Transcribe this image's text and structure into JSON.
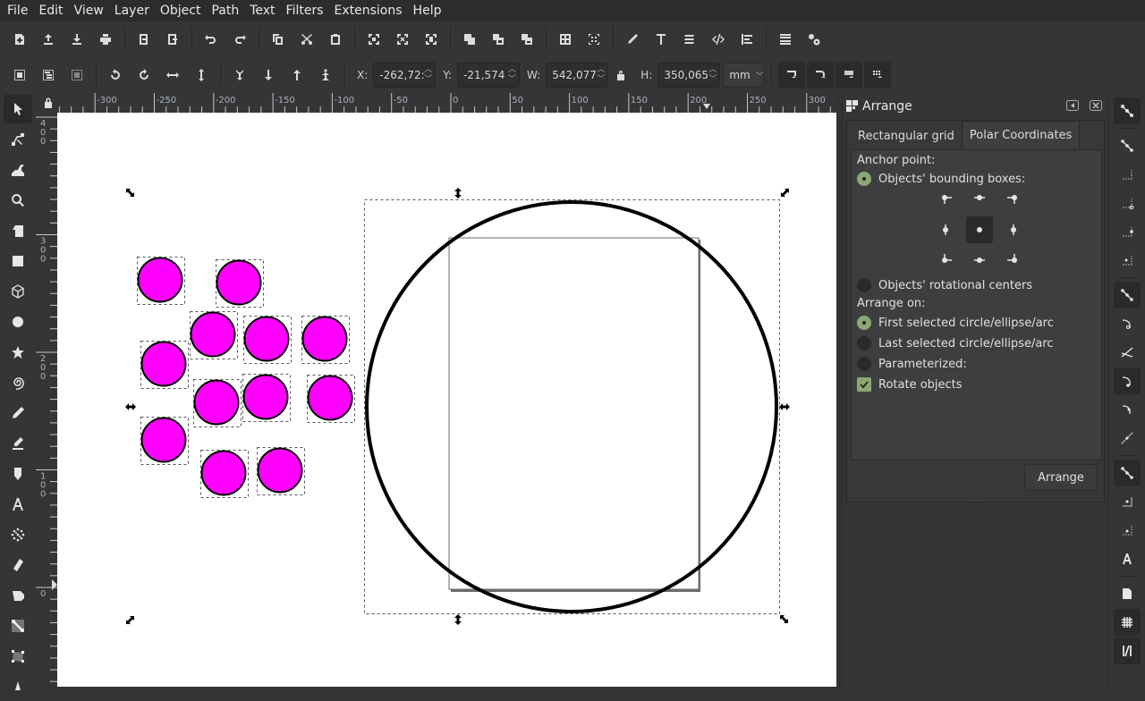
{
  "menu": [
    "File",
    "Edit",
    "View",
    "Layer",
    "Object",
    "Path",
    "Text",
    "Filters",
    "Extensions",
    "Help"
  ],
  "commands_toolbar": [
    "new-document-icon",
    "open-icon",
    "save-icon",
    "print-icon",
    "import-icon",
    "export-icon",
    "undo-icon",
    "redo-icon",
    "copy-icon",
    "cut-icon",
    "paste-icon",
    "zoom-selection-icon",
    "zoom-drawing-icon",
    "zoom-page-icon",
    "duplicate-icon",
    "clone-icon",
    "unlink-clone-icon",
    "group-icon",
    "ungroup-icon",
    "fill-stroke-icon",
    "text-font-icon",
    "layers-icon",
    "xml-editor-icon",
    "align-distribute-icon",
    "preferences-icon",
    "document-properties-icon"
  ],
  "select_toolbar": {
    "x_label": "X:",
    "x_value": "-262,72:",
    "y_label": "Y:",
    "y_value": "-21,574",
    "w_label": "W:",
    "w_value": "542,077",
    "h_label": "H:",
    "h_value": "350,065",
    "unit": "mm"
  },
  "rulers": {
    "top_ticks": [
      "-300",
      "-250",
      "-200",
      "-150",
      "-100",
      "-50",
      "0",
      "50",
      "100",
      "150",
      "200",
      "250",
      "300"
    ],
    "left_ticks": [
      "400",
      "300",
      "200",
      "100",
      "0"
    ]
  },
  "tools": [
    "selector-tool",
    "node-tool",
    "tweak-tool",
    "zoom-tool",
    "measure-tool",
    "rectangle-tool",
    "3d-box-tool",
    "ellipse-tool",
    "star-tool",
    "spiral-tool",
    "pencil-tool",
    "pen-tool",
    "calligraphy-tool",
    "text-tool",
    "spray-tool",
    "eraser-tool",
    "paint-bucket-tool",
    "gradient-tool",
    "mesh-tool",
    "dropper-tool"
  ],
  "dock": {
    "title": "Arrange",
    "tabs": [
      {
        "label": "Rectangular grid",
        "active": false
      },
      {
        "label": "Polar Coordinates",
        "active": true
      }
    ],
    "anchor_point_label": "Anchor point:",
    "bbox_option": "Objects' bounding boxes:",
    "rot_centers_option": "Objects' rotational centers",
    "arrange_on_label": "Arrange on:",
    "first_selected": "First selected circle/ellipse/arc",
    "last_selected": "Last selected circle/ellipse/arc",
    "parameterized": "Parameterized:",
    "rotate_objects": "Rotate objects",
    "arrange_button": "Arrange",
    "anchor_selected": "center",
    "anchor_mode": "bbox",
    "arrange_on": "first",
    "rotate_checked": true
  },
  "canvas": {
    "circle_fill": "#ff00ff",
    "circle_stroke": "#000000",
    "page_border": "#6b6b6b"
  },
  "snap_bar": [
    "snap-toggle-icon",
    "snap-bbox-icon",
    "snap-bbox-edges-icon",
    "snap-bbox-corners-icon",
    "snap-bbox-midpoints-icon",
    "snap-bbox-center-icon",
    "snap-nodes-icon",
    "snap-paths-icon",
    "snap-intersections-icon",
    "snap-cusp-icon",
    "snap-smooth-icon",
    "snap-line-midpoints-icon",
    "snap-others-icon",
    "snap-object-center-icon",
    "snap-rotation-center-icon",
    "snap-text-baseline-icon",
    "snap-page-icon",
    "snap-grid-icon",
    "snap-guide-icon"
  ],
  "accent_color": "#8aa874"
}
